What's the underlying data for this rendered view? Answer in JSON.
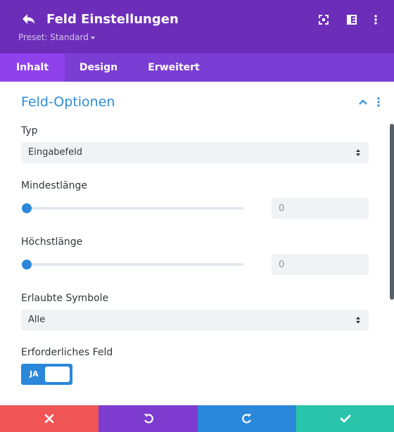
{
  "header": {
    "title": "Feld Einstellungen",
    "preset_label": "Preset: Standard",
    "icons": [
      "back-arrow-icon",
      "screenshot-icon",
      "sidebar-layout-icon",
      "more-vertical-icon"
    ]
  },
  "tabs": [
    {
      "label": "Inhalt",
      "active": true
    },
    {
      "label": "Design",
      "active": false
    },
    {
      "label": "Erweitert",
      "active": false
    }
  ],
  "section": {
    "title": "Feld-Optionen",
    "expanded": true
  },
  "fields": {
    "type": {
      "label": "Typ",
      "value": "Eingabefeld"
    },
    "min_length": {
      "label": "Mindestlänge",
      "value": "0",
      "slider_fraction": 0
    },
    "max_length": {
      "label": "Höchstlänge",
      "value": "0",
      "slider_fraction": 0
    },
    "allowed_symbols": {
      "label": "Erlaubte Symbole",
      "value": "Alle"
    },
    "required": {
      "label": "Erforderliches Feld",
      "toggle_text": "JA",
      "on": true
    }
  },
  "footer": {
    "buttons": [
      {
        "name": "cancel",
        "icon": "close-icon",
        "color": "#ef5555"
      },
      {
        "name": "undo",
        "icon": "undo-icon",
        "color": "#7e3bd0"
      },
      {
        "name": "redo",
        "icon": "redo-icon",
        "color": "#2b87da"
      },
      {
        "name": "save",
        "icon": "check-icon",
        "color": "#29c4a9"
      }
    ]
  },
  "colors": {
    "header_bg": "#6c2eb9",
    "tabs_bg": "#7b3ed4",
    "active_tab_bg": "#8f42ec",
    "accent_blue": "#2b87da",
    "section_title": "#2e8cd9"
  }
}
